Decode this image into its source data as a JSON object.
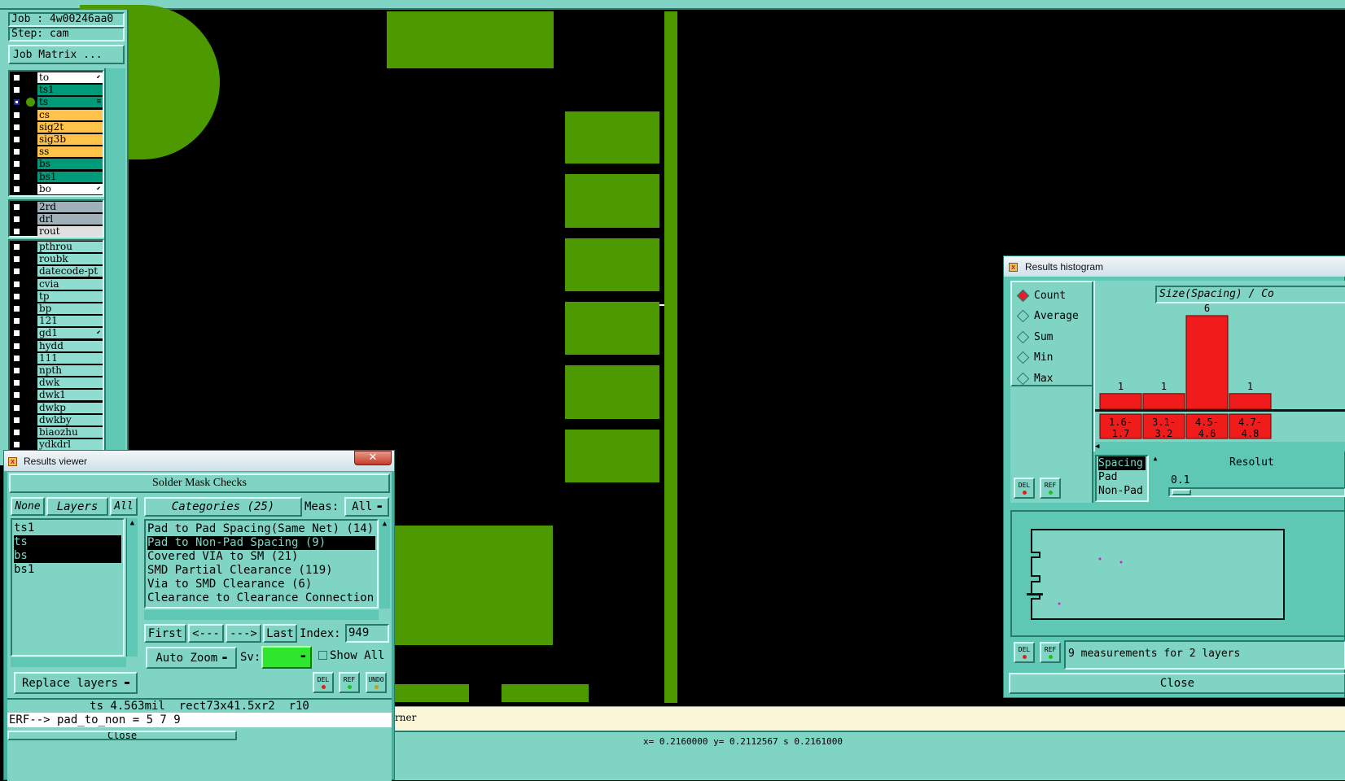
{
  "job_panel": {
    "job": "Job : 4w00246aa0",
    "step": "Step: cam",
    "job_matrix": "Job Matrix ..."
  },
  "layers": {
    "group1": [
      {
        "name": "to",
        "color": "#ffffff",
        "checked": false,
        "mark": "⬋"
      },
      {
        "name": "ts1",
        "color": "#009a78",
        "checked": false,
        "mark": ""
      },
      {
        "name": "ts",
        "color": "#009a78",
        "checked": true,
        "mark": "≡",
        "active": true
      },
      {
        "name": "cs",
        "color": "#ffc24a",
        "checked": false,
        "mark": ""
      },
      {
        "name": "sig2t",
        "color": "#ffc24a",
        "checked": false,
        "mark": ""
      },
      {
        "name": "sig3b",
        "color": "#ffc24a",
        "checked": false,
        "mark": ""
      },
      {
        "name": "ss",
        "color": "#ffc24a",
        "checked": false,
        "mark": ""
      },
      {
        "name": "bs",
        "color": "#009a78",
        "checked": false,
        "mark": ""
      },
      {
        "name": "bs1",
        "color": "#009a78",
        "checked": false,
        "mark": ""
      },
      {
        "name": "bo",
        "color": "#ffffff",
        "checked": false,
        "mark": "⬋"
      }
    ],
    "group2": [
      {
        "name": "2rd",
        "color": "#9fb0b8",
        "checked": false,
        "mark": ""
      },
      {
        "name": "drl",
        "color": "#9fb0b8",
        "checked": false,
        "mark": ""
      },
      {
        "name": "rout",
        "color": "#e0e0e0",
        "checked": false,
        "mark": ""
      }
    ],
    "group3": [
      {
        "name": "pthrou",
        "color": "#8fdcd0",
        "checked": false,
        "mark": ""
      },
      {
        "name": "roubk",
        "color": "#8fdcd0",
        "checked": false,
        "mark": ""
      },
      {
        "name": "datecode-pt",
        "color": "#8fdcd0",
        "checked": false,
        "mark": ""
      },
      {
        "name": "cvia",
        "color": "#8fdcd0",
        "checked": false,
        "mark": ""
      },
      {
        "name": "tp",
        "color": "#8fdcd0",
        "checked": false,
        "mark": ""
      },
      {
        "name": "bp",
        "color": "#8fdcd0",
        "checked": false,
        "mark": ""
      },
      {
        "name": "121",
        "color": "#8fdcd0",
        "checked": false,
        "mark": ""
      },
      {
        "name": "gd1",
        "color": "#8fdcd0",
        "checked": false,
        "mark": "⬋"
      },
      {
        "name": "hydd",
        "color": "#8fdcd0",
        "checked": false,
        "mark": ""
      },
      {
        "name": "111",
        "color": "#8fdcd0",
        "checked": false,
        "mark": ""
      },
      {
        "name": "npth",
        "color": "#8fdcd0",
        "checked": false,
        "mark": ""
      },
      {
        "name": "dwk",
        "color": "#8fdcd0",
        "checked": false,
        "mark": ""
      },
      {
        "name": "dwk1",
        "color": "#8fdcd0",
        "checked": false,
        "mark": ""
      },
      {
        "name": "dwkp",
        "color": "#8fdcd0",
        "checked": false,
        "mark": ""
      },
      {
        "name": "dwkby",
        "color": "#8fdcd0",
        "checked": false,
        "mark": ""
      },
      {
        "name": "biaozhu",
        "color": "#8fdcd0",
        "checked": false,
        "mark": ""
      },
      {
        "name": "ydkdrl",
        "color": "#8fdcd0",
        "checked": false,
        "mark": ""
      }
    ]
  },
  "results_viewer": {
    "title": "Results viewer",
    "heading": "Solder Mask Checks",
    "none_btn": "None",
    "layers_btn": "Layers",
    "all_btn": "All",
    "layer_list": [
      "ts1",
      "ts",
      "bs",
      "bs1"
    ],
    "categories_btn": "Categories (25)",
    "meas_label": "Meas:",
    "meas_value": "All",
    "categories": [
      "Pad to Pad Spacing(Same Net) (14)",
      "Pad to Non-Pad Spacing (9)",
      "Covered VIA to SM (21)",
      "SMD Partial Clearance (119)",
      "Via to SMD Clearance (6)",
      "Clearance to Clearance Connection"
    ],
    "first_btn": "First",
    "prev_btn": "<---",
    "next_btn": "--->",
    "last_btn": "Last",
    "index_label": "Index:",
    "index_value": "949",
    "auto_zoom": "Auto Zoom",
    "sv_label": "Sv:",
    "show_all": "Show All",
    "replace_layers": "Replace layers",
    "del": "DEL",
    "ref": "REF",
    "undo": "UNDO",
    "info": "ts 4.563mil  rect73x41.5xr2  r10",
    "erf": "ERF--> pad_to_non = 5 7 9",
    "close": "Close"
  },
  "histogram": {
    "title": "Results histogram",
    "radios": [
      {
        "label": "Count",
        "on": true
      },
      {
        "label": "Average",
        "on": false
      },
      {
        "label": "Sum",
        "on": false
      },
      {
        "label": "Min",
        "on": false
      },
      {
        "label": "Max",
        "on": false
      }
    ],
    "chart_title": "Size(Spacing) / Co",
    "bins": [
      {
        "label": "1.6-\n1.7",
        "count": 1
      },
      {
        "label": "3.1-\n3.2",
        "count": 1
      },
      {
        "label": "4.5-\n4.6",
        "count": 6
      },
      {
        "label": "4.7-\n4.8",
        "count": 1
      }
    ],
    "type_list": [
      "Spacing",
      "Pad",
      "Non-Pad"
    ],
    "resolution_label": "Resolut",
    "resolution_value": "0.1",
    "del": "DEL",
    "ref": "REF",
    "measurements": "9 measurements for 2 layers",
    "close": "Close"
  },
  "statusbar": {
    "hint": "rner",
    "coords": "x= 0.2160000 y= 0.2112567 s 0.2161000"
  }
}
